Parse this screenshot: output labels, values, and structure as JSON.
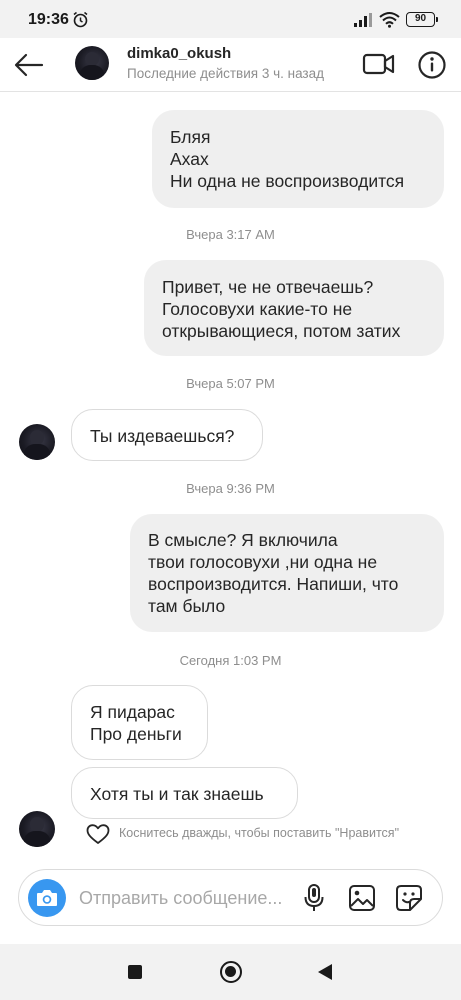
{
  "status_bar": {
    "time": "19:36",
    "battery": "90"
  },
  "header": {
    "username": "dimka0_okush",
    "last_seen": "Последние действия 3 ч. назад"
  },
  "messages": {
    "m1": "Бляя\nАхах\nНи одна не воспроизводится",
    "ts1": "Вчера 3:17 AM",
    "m2": "Привет, че не отвечаешь?\nГолосовухи какие-то не\nоткрывающиеся, потом затих",
    "ts2": "Вчера 5:07 PM",
    "m3": "Ты издеваешься?",
    "ts3": "Вчера 9:36 PM",
    "m4": "В смысле? Я включила\nтвои голосовухи ,ни одна не\nвоспроизводится. Напиши, что\nтам было",
    "ts4": "Сегодня 1:03 PM",
    "m5": "Я пидарас\nПро деньги",
    "m6": "Хотя ты и так знаешь"
  },
  "like_hint": "Коснитесь дважды, чтобы поставить \"Нравится\"",
  "composer": {
    "placeholder": "Отправить сообщение..."
  },
  "colors": {
    "accent": "#3897f0",
    "outgoing_bubble": "#efefef",
    "muted_text": "#8e8e8e"
  },
  "icons": [
    "alarm-icon",
    "signal-icon",
    "wifi-icon",
    "back-arrow-icon",
    "video-call-icon",
    "info-icon",
    "heart-icon",
    "camera-icon",
    "microphone-icon",
    "gallery-icon",
    "sticker-icon"
  ]
}
